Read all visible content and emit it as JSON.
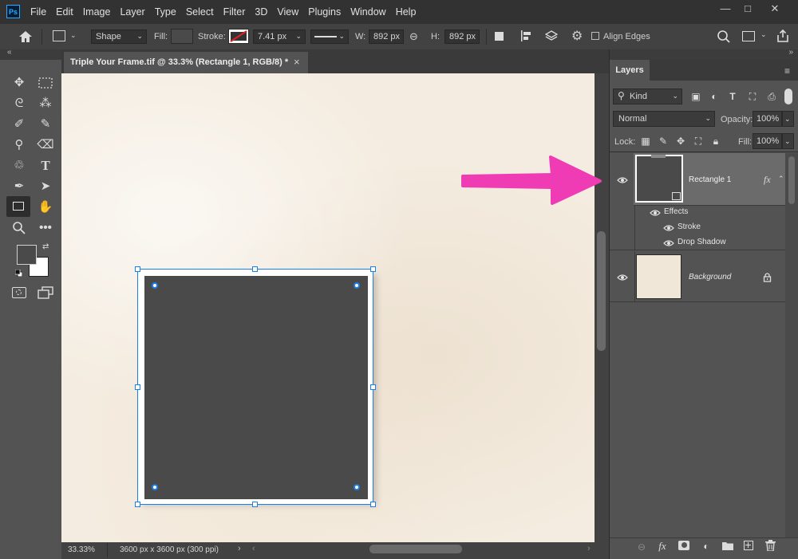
{
  "app": {
    "logo_text": "Ps"
  },
  "menu": [
    "File",
    "Edit",
    "Image",
    "Layer",
    "Type",
    "Select",
    "Filter",
    "3D",
    "View",
    "Plugins",
    "Window",
    "Help"
  ],
  "window_controls": {
    "minimize": "—",
    "maximize": "□",
    "close": "✕"
  },
  "options_bar": {
    "mode": "Shape",
    "fill_label": "Fill:",
    "stroke_label": "Stroke:",
    "stroke_width": "7.41 px",
    "w_label": "W:",
    "width": "892 px",
    "h_label": "H:",
    "height": "892 px",
    "align_edges_label": "Align Edges"
  },
  "document": {
    "tab_title": "Triple Your Frame.tif @ 33.3% (Rectangle 1, RGB/8) *",
    "close_glyph": "×",
    "zoom": "33.33%",
    "info": "3600 px x 3600 px (300 ppi)"
  },
  "layers_panel": {
    "tab_label": "Layers",
    "filter_kind": "Kind",
    "blend_mode": "Normal",
    "opacity_label": "Opacity:",
    "opacity": "100%",
    "lock_label": "Lock:",
    "fill_label": "Fill:",
    "fill": "100%",
    "layers": [
      {
        "name": "Rectangle 1",
        "fx": "fx",
        "effects_label": "Effects",
        "effects": [
          "Stroke",
          "Drop Shadow"
        ]
      },
      {
        "name": "Background"
      }
    ]
  },
  "colors": {
    "accent": "#1a7fe6",
    "arrow": "#f03cb4",
    "ui_dark": "#323232",
    "ui_mid": "#535353",
    "shape_fill": "#4a4a4a",
    "paper": "#f4ece0"
  }
}
